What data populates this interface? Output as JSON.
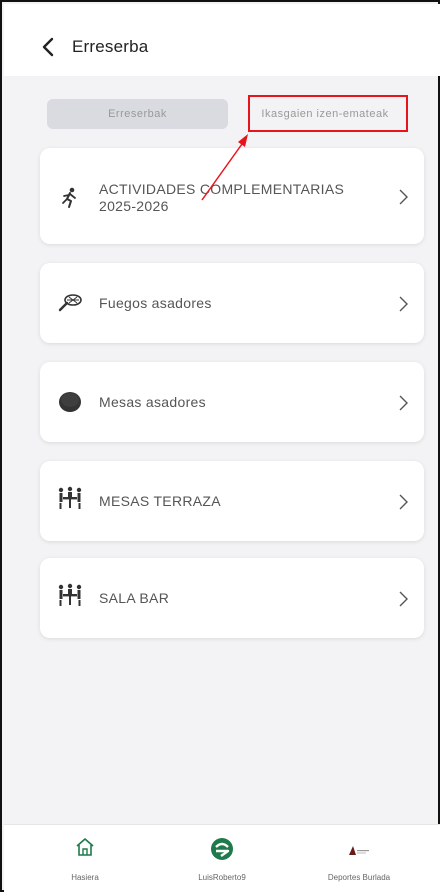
{
  "header": {
    "title": "Erreserba"
  },
  "tabs": [
    {
      "label": "Erreserbak"
    },
    {
      "label": "Ikasgaien izen-emateak"
    }
  ],
  "cards": [
    {
      "label_line1": "ACTIVIDADES COMPLEMENTARIAS",
      "label_line2": "2025-2026",
      "icon": "runner-icon"
    },
    {
      "label": "Fuegos asadores",
      "icon": "grill-icon"
    },
    {
      "label": "Mesas asadores",
      "icon": "table-round-icon"
    },
    {
      "label": "MESAS TERRAZA",
      "icon": "people-table-icon"
    },
    {
      "label": "SALA BAR",
      "icon": "people-table-icon"
    }
  ],
  "bottom_nav": [
    {
      "label": "Hasiera",
      "icon": "home-icon"
    },
    {
      "label": "LuisRoberto9",
      "icon": "profile-logo-icon"
    },
    {
      "label": "Deportes Burlada",
      "icon": "club-logo-icon"
    }
  ],
  "colors": {
    "accent_green": "#1e7a4a",
    "highlight_red": "#e8141b"
  }
}
